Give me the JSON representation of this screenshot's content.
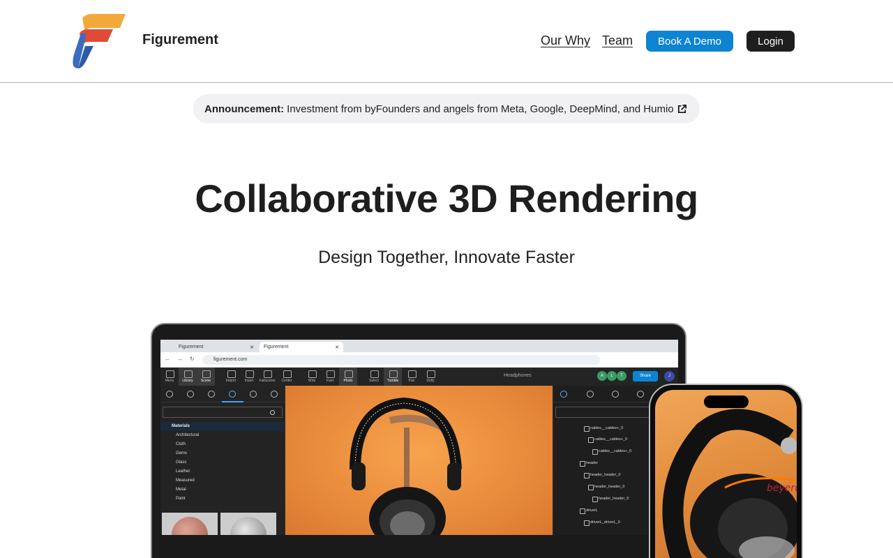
{
  "brand": {
    "name": "Figurement"
  },
  "nav": {
    "our_why": "Our Why",
    "team": "Team",
    "book_demo": "Book A Demo",
    "login": "Login"
  },
  "announcement": {
    "label": "Announcement:",
    "text": "Investment from byFounders and angels from Meta, Google, DeepMind, and Humio"
  },
  "hero": {
    "title": "Collaborative 3D Rendering",
    "subtitle": "Design Together, Innovate Faster"
  },
  "app_preview": {
    "tabs": [
      "Figurement",
      "Figurement"
    ],
    "url": "figurement.com",
    "toolbar": [
      "Menu",
      "Library",
      "Scene",
      "Import",
      "Insert",
      "Fullscreen",
      "Center",
      "Wire",
      "Fast",
      "Photo",
      "Select",
      "Tumble",
      "Pan",
      "Dolly"
    ],
    "document_title": "Headphones",
    "avatars": [
      "A",
      "L",
      "T"
    ],
    "share_label": "Share",
    "user_initial": "J",
    "materials_header": "Materials",
    "materials": [
      "Architectural",
      "Cloth",
      "Gems",
      "Glass",
      "Leather",
      "Measured",
      "Metal",
      "Paint"
    ],
    "scene_tree": [
      "cables__cables+_0",
      "cables__cables+_0",
      "cables__cables+_0",
      "header",
      "header_header_0",
      "header_header_0",
      "header_header_0",
      "driverL",
      "driverL_driverL_0"
    ]
  },
  "colors": {
    "primary": "#0d84d1",
    "dark": "#1e1e1e",
    "announcement_bg": "#f1f1f3"
  }
}
